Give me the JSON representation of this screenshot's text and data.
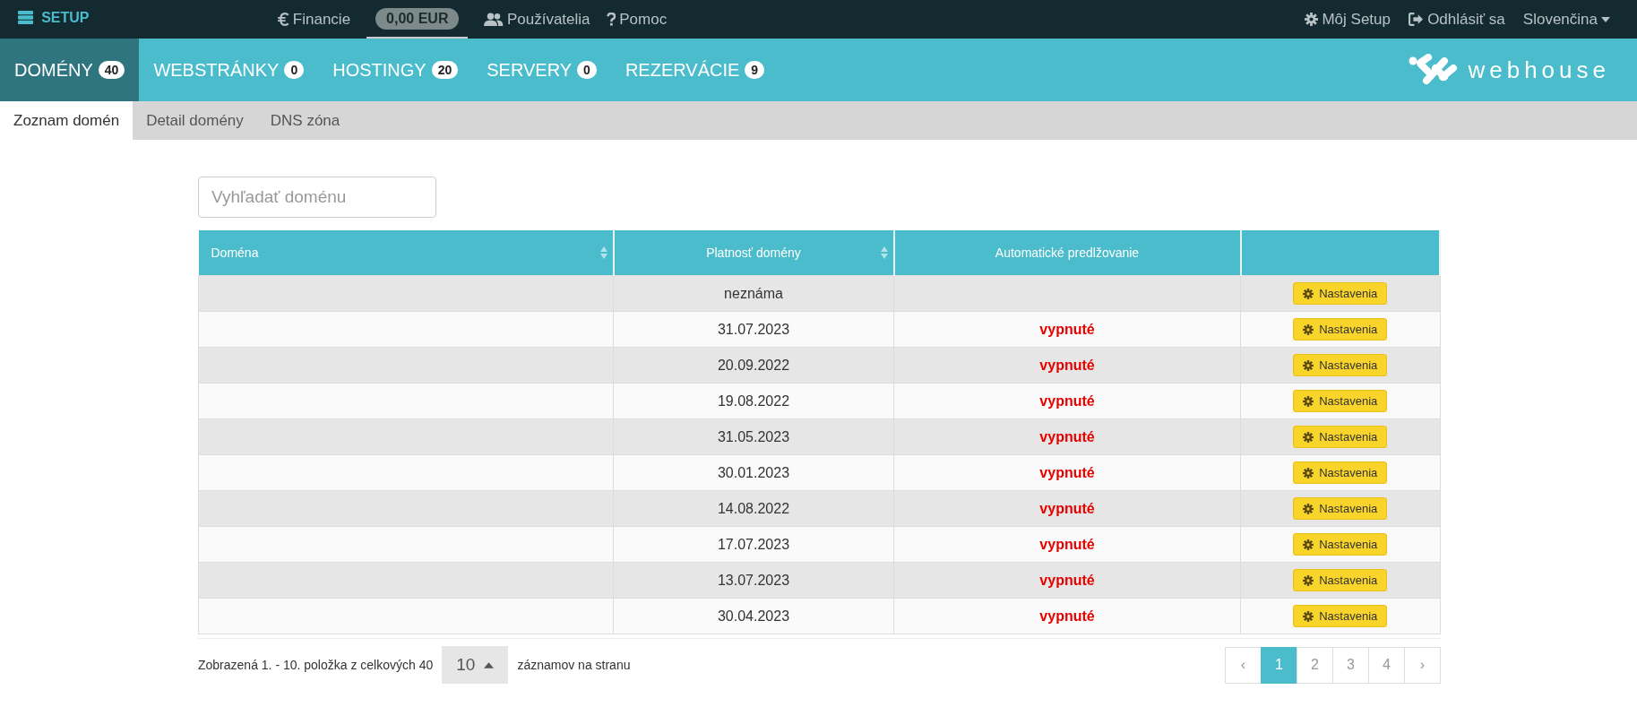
{
  "top_bar": {
    "brand": "SETUP",
    "items": [
      {
        "kind": "euro",
        "label": "Financie"
      },
      {
        "kind": "users",
        "label": "Používatelia"
      },
      {
        "kind": "help",
        "label": "Pomoc"
      }
    ],
    "balance": "0,00 EUR",
    "right_items": [
      {
        "kind": "gear",
        "label": "Môj Setup"
      },
      {
        "kind": "logout",
        "label": "Odhlásiť sa"
      },
      {
        "kind": "dropdown",
        "label": "Slovenčina"
      }
    ]
  },
  "main_tabs": [
    {
      "label": "DOMÉNY",
      "count": "40",
      "selected": true
    },
    {
      "label": "WEBSTRÁNKY",
      "count": "0",
      "selected": false
    },
    {
      "label": "HOSTINGY",
      "count": "20",
      "selected": false
    },
    {
      "label": "SERVERY",
      "count": "0",
      "selected": false
    },
    {
      "label": "REZERVÁCIE",
      "count": "9",
      "selected": false
    }
  ],
  "logo": "webhouse",
  "sub_tabs": [
    {
      "label": "Zoznam domén",
      "selected": true
    },
    {
      "label": "Detail domény",
      "selected": false
    },
    {
      "label": "DNS zóna",
      "selected": false
    }
  ],
  "search": {
    "placeholder": "Vyhľadať doménu"
  },
  "table": {
    "columns": [
      {
        "label": "Doména",
        "sortable": true
      },
      {
        "label": "Platnosť domény",
        "sortable": true
      },
      {
        "label": "Automatické predlžovanie",
        "sortable": false
      },
      {
        "sortable": false
      }
    ],
    "rows": [
      {
        "validity": "neznáma",
        "action": "Nastavenia"
      },
      {
        "validity": "31.07.2023",
        "auto_renew": {
          "text": "vypnuté",
          "on": false
        },
        "action": "Nastavenia"
      },
      {
        "validity": "20.09.2022",
        "auto_renew": {
          "text": "vypnuté",
          "on": false
        },
        "action": "Nastavenia"
      },
      {
        "validity": "19.08.2022",
        "auto_renew": {
          "text": "vypnuté",
          "on": false
        },
        "action": "Nastavenia"
      },
      {
        "validity": "31.05.2023",
        "auto_renew": {
          "text": "vypnuté",
          "on": false
        },
        "action": "Nastavenia"
      },
      {
        "validity": "30.01.2023",
        "auto_renew": {
          "text": "vypnuté",
          "on": false
        },
        "action": "Nastavenia"
      },
      {
        "validity": "14.08.2022",
        "auto_renew": {
          "text": "vypnuté",
          "on": false
        },
        "action": "Nastavenia"
      },
      {
        "validity": "17.07.2023",
        "auto_renew": {
          "text": "vypnuté",
          "on": false
        },
        "action": "Nastavenia"
      },
      {
        "validity": "13.07.2023",
        "auto_renew": {
          "text": "vypnuté",
          "on": false
        },
        "action": "Nastavenia"
      },
      {
        "validity": "30.04.2023",
        "auto_renew": {
          "text": "vypnuté",
          "on": false
        },
        "action": "Nastavenia"
      }
    ]
  },
  "footer": {
    "summary": "Zobrazená 1. - 10. položka z celkových 40",
    "per_page": "10",
    "per_page_label": "záznamov na stranu",
    "prev": "‹",
    "next": "›",
    "pages": [
      {
        "label": "1",
        "selected": true
      },
      {
        "label": "2",
        "selected": false
      },
      {
        "label": "3",
        "selected": false
      },
      {
        "label": "4",
        "selected": false
      }
    ]
  }
}
